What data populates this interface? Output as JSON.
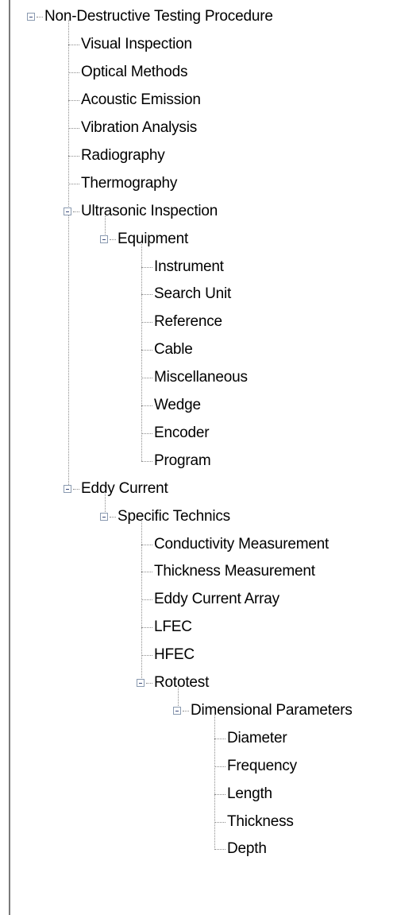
{
  "tree": {
    "root": {
      "label": "Non-Destructive Testing Procedure",
      "expanded": true,
      "children": [
        {
          "label": "Visual Inspection"
        },
        {
          "label": "Optical Methods"
        },
        {
          "label": "Acoustic Emission"
        },
        {
          "label": "Vibration Analysis"
        },
        {
          "label": "Radiography"
        },
        {
          "label": "Thermography"
        },
        {
          "label": "Ultrasonic Inspection",
          "expanded": true,
          "children": [
            {
              "label": "Equipment",
              "expanded": true,
              "children": [
                {
                  "label": "Instrument"
                },
                {
                  "label": "Search Unit"
                },
                {
                  "label": "Reference"
                },
                {
                  "label": "Cable"
                },
                {
                  "label": "Miscellaneous"
                },
                {
                  "label": "Wedge"
                },
                {
                  "label": "Encoder"
                },
                {
                  "label": "Program"
                }
              ]
            }
          ]
        },
        {
          "label": "Eddy Current",
          "expanded": true,
          "children": [
            {
              "label": "Specific Technics",
              "expanded": true,
              "children": [
                {
                  "label": "Conductivity Measurement"
                },
                {
                  "label": "Thickness Measurement"
                },
                {
                  "label": "Eddy Current Array"
                },
                {
                  "label": "LFEC"
                },
                {
                  "label": "HFEC"
                },
                {
                  "label": "Rototest",
                  "expanded": true,
                  "children": [
                    {
                      "label": "Dimensional Parameters",
                      "expanded": true,
                      "children": [
                        {
                          "label": "Diameter"
                        },
                        {
                          "label": "Frequency"
                        },
                        {
                          "label": "Length"
                        },
                        {
                          "label": "Thickness"
                        },
                        {
                          "label": "Depth"
                        }
                      ]
                    }
                  ]
                }
              ]
            }
          ]
        }
      ]
    }
  },
  "icons": {
    "expanded_toggle": "minus-box-icon"
  }
}
